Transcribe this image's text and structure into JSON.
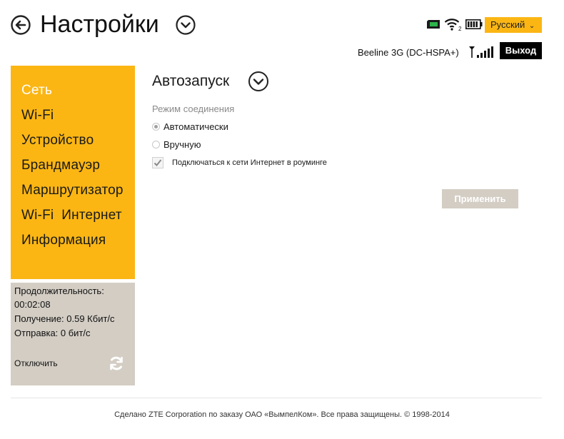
{
  "header": {
    "title": "Настройки",
    "language": "Русский",
    "network_name": "Beeline 3G (DC-HSPA+)",
    "logout_label": "Выход",
    "wifi_clients": "2"
  },
  "sidebar": {
    "items": [
      {
        "label": "Сеть",
        "active": true
      },
      {
        "label": "Wi-Fi",
        "active": false
      },
      {
        "label": "Устройство",
        "active": false
      },
      {
        "label": "Брандмауэр",
        "active": false
      },
      {
        "label": "Маршрутизатор",
        "active": false
      },
      {
        "label": "Wi-Fi  Интернет",
        "active": false
      },
      {
        "label": "Информация",
        "active": false
      }
    ]
  },
  "status": {
    "duration_label": "Продолжительность:",
    "duration_value": "00:02:08",
    "receive": "Получение: 0.59 Кбит/с",
    "send": "Отправка: 0 бит/с",
    "disconnect_label": "Отключить"
  },
  "main": {
    "section_title": "Автозапуск",
    "mode_label": "Режим соединения",
    "options": [
      {
        "label": "Автоматически",
        "checked": true
      },
      {
        "label": "Вручную",
        "checked": false
      }
    ],
    "roaming_label": "Подключаться к сети Интернет в роуминге",
    "roaming_checked": true,
    "apply_label": "Применить"
  },
  "footer": {
    "text": "Сделано ZTE Corporation по заказу ОАО «ВымпелКом». Все права защищены. © 1998-2014"
  },
  "colors": {
    "accent": "#fbb614",
    "panel": "#d3cdc4",
    "logout_bg": "#000000"
  }
}
